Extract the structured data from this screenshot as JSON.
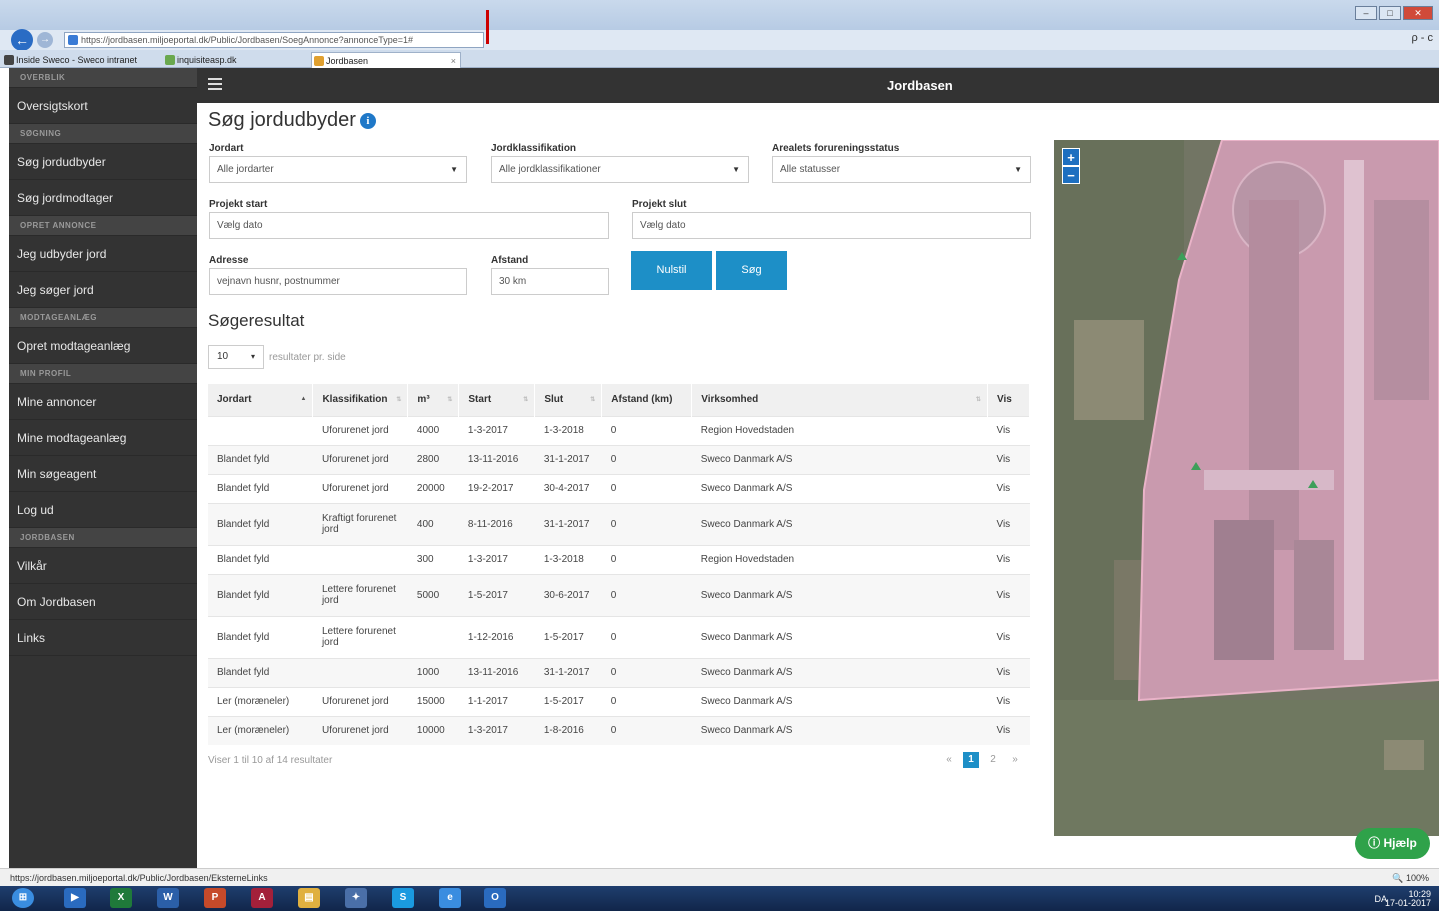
{
  "browser": {
    "url": "https://jordbasen.miljoeportal.dk/Public/Jordbasen/SoegAnnonce?annonceType=1#",
    "search_hint": "ρ - c",
    "tabs": [
      {
        "label": "Inside Sweco - Sweco intranet"
      },
      {
        "label": "inquisiteasp.dk"
      },
      {
        "label": "Jordbasen",
        "close": "×"
      }
    ]
  },
  "sidebar": {
    "sections": [
      {
        "header": "OVERBLIK",
        "items": [
          "Oversigtskort"
        ]
      },
      {
        "header": "SØGNING",
        "items": [
          "Søg jordudbyder",
          "Søg jordmodtager"
        ]
      },
      {
        "header": "OPRET ANNONCE",
        "items": [
          "Jeg udbyder jord",
          "Jeg søger jord"
        ]
      },
      {
        "header": "MODTAGEANLÆG",
        "items": [
          "Opret modtageanlæg"
        ]
      },
      {
        "header": "MIN PROFIL",
        "items": [
          "Mine annoncer",
          "Mine modtageanlæg",
          "Min søgeagent",
          "Log ud"
        ]
      },
      {
        "header": "JORDBASEN",
        "items": [
          "Vilkår",
          "Om Jordbasen",
          "Links"
        ]
      }
    ]
  },
  "header": {
    "title": "Jordbasen"
  },
  "search": {
    "title": "Søg jordudbyder",
    "jordart_label": "Jordart",
    "jordart_value": "Alle jordarter",
    "klass_label": "Jordklassifikation",
    "klass_value": "Alle jordklassifikationer",
    "status_label": "Arealets forureningsstatus",
    "status_value": "Alle statusser",
    "start_label": "Projekt start",
    "start_placeholder": "Vælg dato",
    "slut_label": "Projekt slut",
    "slut_placeholder": "Vælg dato",
    "adresse_label": "Adresse",
    "adresse_placeholder": "vejnavn husnr, postnummer",
    "afstand_label": "Afstand",
    "afstand_value": "30 km",
    "reset_label": "Nulstil",
    "search_label": "Søg"
  },
  "results": {
    "title": "Søgeresultat",
    "per_page": "10",
    "per_page_label": "resultater pr. side",
    "columns": [
      "Jordart",
      "Klassifikation",
      "m³",
      "Start",
      "Slut",
      "Afstand (km)",
      "Virksomhed",
      "Vis"
    ],
    "rows": [
      [
        "",
        "Uforurenet jord",
        "4000",
        "1-3-2017",
        "1-3-2018",
        "0",
        "Region Hovedstaden",
        "Vis"
      ],
      [
        "Blandet fyld",
        "Uforurenet jord",
        "2800",
        "13-11-2016",
        "31-1-2017",
        "0",
        "Sweco Danmark A/S",
        "Vis"
      ],
      [
        "Blandet fyld",
        "Uforurenet jord",
        "20000",
        "19-2-2017",
        "30-4-2017",
        "0",
        "Sweco Danmark A/S",
        "Vis"
      ],
      [
        "Blandet fyld",
        "Kraftigt forurenet jord",
        "400",
        "8-11-2016",
        "31-1-2017",
        "0",
        "Sweco Danmark A/S",
        "Vis"
      ],
      [
        "Blandet fyld",
        "",
        "300",
        "1-3-2017",
        "1-3-2018",
        "0",
        "Region Hovedstaden",
        "Vis"
      ],
      [
        "Blandet fyld",
        "Lettere forurenet jord",
        "5000",
        "1-5-2017",
        "30-6-2017",
        "0",
        "Sweco Danmark A/S",
        "Vis"
      ],
      [
        "Blandet fyld",
        "Lettere forurenet jord",
        "",
        "1-12-2016",
        "1-5-2017",
        "0",
        "Sweco Danmark A/S",
        "Vis"
      ],
      [
        "Blandet fyld",
        "",
        "1000",
        "13-11-2016",
        "31-1-2017",
        "0",
        "Sweco Danmark A/S",
        "Vis"
      ],
      [
        "Ler (moræneler)",
        "Uforurenet jord",
        "15000",
        "1-1-2017",
        "1-5-2017",
        "0",
        "Sweco Danmark A/S",
        "Vis"
      ],
      [
        "Ler (moræneler)",
        "Uforurenet jord",
        "10000",
        "1-3-2017",
        "1-8-2016",
        "0",
        "Sweco Danmark A/S",
        "Vis"
      ]
    ],
    "info": "Viser 1 til 10 af 14 resultater",
    "pager": {
      "prev": "«",
      "current": "1",
      "next_page": "2",
      "next": "»"
    }
  },
  "map": {
    "zoom_in": "+",
    "zoom_out": "−"
  },
  "help": {
    "label": "Hjælp"
  },
  "status": {
    "url": "https://jordbasen.miljoeportal.dk/Public/Jordbasen/EksterneLinks",
    "zoom": "100%"
  },
  "tray": {
    "lang": "DA",
    "time": "10:29",
    "date": "17-01-2017"
  }
}
